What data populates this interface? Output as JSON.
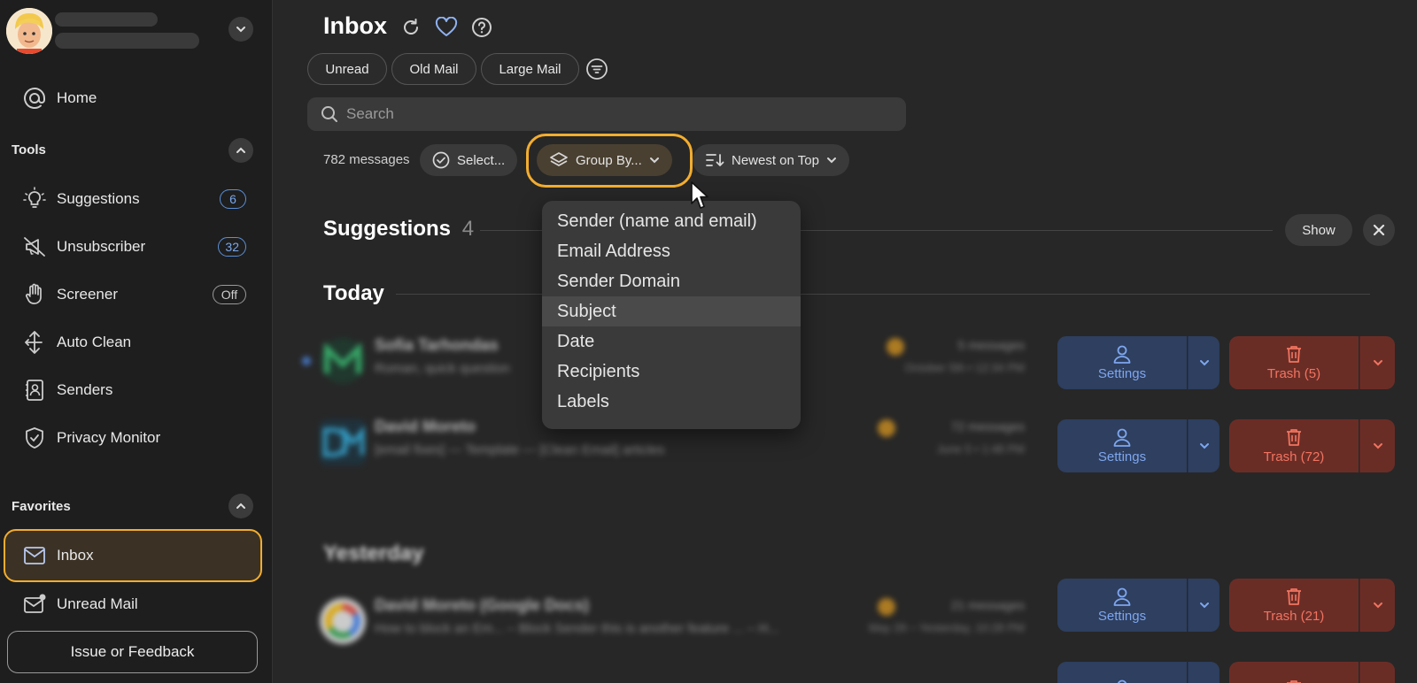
{
  "sidebar": {
    "nav": [
      {
        "label": "Home",
        "icon": "at-icon"
      },
      {
        "label": "Suggestions",
        "icon": "lightbulb-icon",
        "badge": "6"
      },
      {
        "label": "Unsubscriber",
        "icon": "megaphone-off-icon",
        "badge": "32"
      },
      {
        "label": "Screener",
        "icon": "hand-icon",
        "badge": "Off"
      },
      {
        "label": "Auto Clean",
        "icon": "arrows-icon"
      },
      {
        "label": "Senders",
        "icon": "contact-book-icon"
      },
      {
        "label": "Privacy Monitor",
        "icon": "shield-check-icon"
      }
    ],
    "tools_label": "Tools",
    "favorites_label": "Favorites",
    "favorites": [
      {
        "label": "Inbox",
        "icon": "inbox-icon"
      },
      {
        "label": "Unread Mail",
        "icon": "unread-mail-icon"
      }
    ],
    "feedback_label": "Issue or Feedback"
  },
  "header": {
    "title": "Inbox",
    "filters": [
      "Unread",
      "Old Mail",
      "Large Mail"
    ]
  },
  "search": {
    "placeholder": "Search"
  },
  "toolbar": {
    "message_count": "782 messages",
    "select_label": "Select...",
    "group_by_label": "Group By...",
    "sort_label": "Newest on Top"
  },
  "group_by_menu": {
    "options": [
      "Sender (name and email)",
      "Email Address",
      "Sender Domain",
      "Subject",
      "Date",
      "Recipients",
      "Labels"
    ],
    "highlighted": "Subject"
  },
  "suggestions": {
    "title": "Suggestions",
    "count": "4",
    "show_label": "Show"
  },
  "sections": {
    "today": "Today",
    "yesterday": "Yesterday"
  },
  "rows": [
    {
      "sender": "Sofia Tarhondas",
      "subject": "Roman, quick question",
      "count": "5 messages",
      "date": "October 5th • 12:34 PM",
      "settings": "Settings",
      "trash": "Trash (5)"
    },
    {
      "sender": "David Moreto",
      "subject": "[email fixes] — Template — [Clean Email] articles",
      "count": "72 messages",
      "date": "June 5 • 1:48 PM",
      "settings": "Settings",
      "trash": "Trash (72)"
    },
    {
      "sender": "David Moreto (Google Docs)",
      "subject": "How to block an Em... – Block Sender this is another feature ... – H...",
      "count": "21 messages",
      "date": "May 29 – Yesterday, 10:28 PM",
      "settings": "Settings",
      "trash": "Trash (21)"
    }
  ],
  "colors": {
    "accent": "#f3ad2f",
    "settings_blue": "#7ea6ef",
    "trash_red": "#f17460"
  }
}
